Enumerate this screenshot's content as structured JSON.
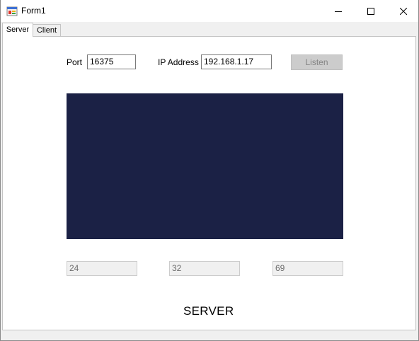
{
  "window": {
    "title": "Form1",
    "colors": {
      "panel": "#1b2145",
      "titlebar": "#ffffff",
      "client_bg": "#f0f0f0"
    },
    "icons": {
      "app": "form-app-icon",
      "minimize": "minimize-icon",
      "maximize": "maximize-icon",
      "close": "close-icon"
    }
  },
  "tabs": [
    {
      "label": "Server",
      "active": true
    },
    {
      "label": "Client",
      "active": false
    }
  ],
  "server": {
    "port_label": "Port",
    "port_value": "16375",
    "ip_label": "IP Address",
    "ip_value": "192.168.1.17",
    "listen_label": "Listen",
    "listen_enabled": false,
    "values": [
      "24",
      "32",
      "69"
    ],
    "footer_label": "SERVER"
  }
}
